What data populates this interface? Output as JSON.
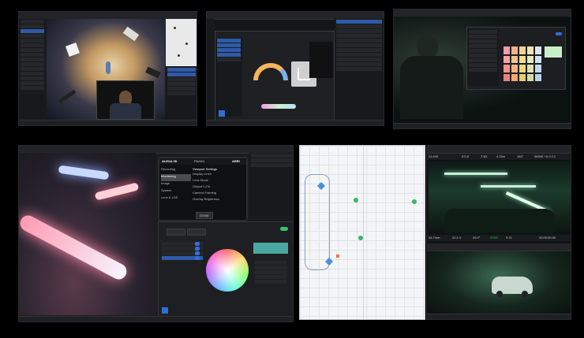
{
  "panel4": {
    "camera_brand": "ALEXA 35",
    "camera_mode": "PAAKU",
    "camera_logo": "ARRI",
    "menu_items": [
      "Recording",
      "Monitoring",
      "Image",
      "System",
      "Lens & LDS"
    ],
    "settings_title": "Viewport Settings",
    "settings_rows": [
      "Display Lines",
      "Lens Mode",
      "Output LUTs",
      "Camera Framing",
      "Overlay Brightness"
    ],
    "done_label": "DONE"
  },
  "panel6": {
    "hud_values": [
      "24.000",
      "5TL8",
      "7.13",
      "4.33m",
      "180°",
      "5600K +0.0 CC"
    ],
    "hud_bottom": [
      "44.7mm",
      "22.5 V",
      "25.0°",
      "STBY",
      "9.21",
      "00:00:00:00"
    ]
  },
  "colors": {
    "accent": "#2f6fd6",
    "panel_bg": "#1b1c1f",
    "teal_swatch": "#4aa8a0",
    "green_toggle": "#3cc26b"
  }
}
